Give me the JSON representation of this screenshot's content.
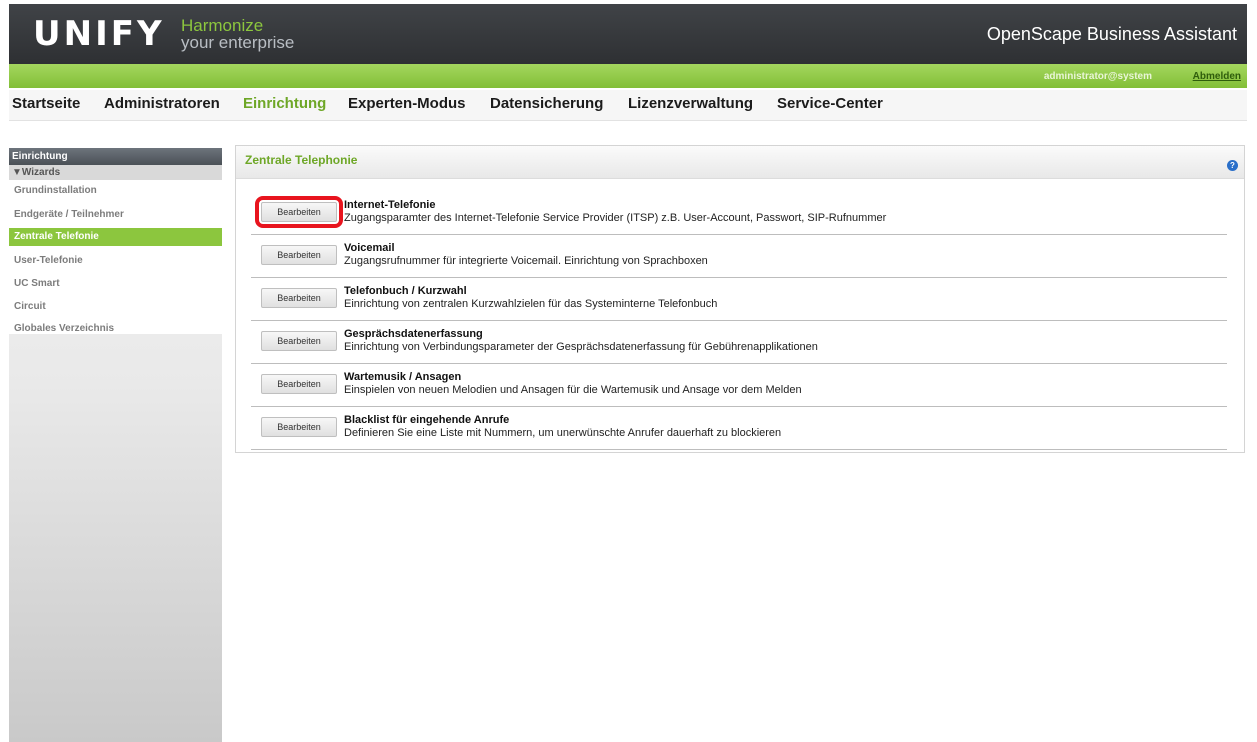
{
  "header": {
    "logo": "UNIFY",
    "tagline_line1": "Harmonize",
    "tagline_line2": "your enterprise",
    "product_title": "OpenScape Business Assistant"
  },
  "userbar": {
    "user": "administrator@system",
    "logout": "Abmelden"
  },
  "mainnav": {
    "items": [
      {
        "label": "Startseite"
      },
      {
        "label": "Administratoren"
      },
      {
        "label": "Einrichtung",
        "active": true
      },
      {
        "label": "Experten-Modus"
      },
      {
        "label": "Datensicherung"
      },
      {
        "label": "Lizenzverwaltung"
      },
      {
        "label": "Service-Center"
      }
    ]
  },
  "sidebar": {
    "heading": "Einrichtung",
    "group": "▼Wizards",
    "items": [
      {
        "label": "Grundinstallation"
      },
      {
        "label": "Endgeräte / Teilnehmer"
      },
      {
        "label": "Zentrale Telefonie",
        "active": true
      },
      {
        "label": "User-Telefonie"
      },
      {
        "label": "UC Smart"
      },
      {
        "label": "Circuit"
      },
      {
        "label": "Globales Verzeichnis"
      }
    ]
  },
  "panel": {
    "title": "Zentrale Telephonie",
    "help_icon": "help-icon",
    "rows": [
      {
        "button": "Bearbeiten",
        "title": "Internet-Telefonie",
        "desc": "Zugangsparamter des Internet-Telefonie Service Provider (ITSP) z.B. User-Account, Passwort, SIP-Rufnummer",
        "highlighted": true
      },
      {
        "button": "Bearbeiten",
        "title": "Voicemail",
        "desc": "Zugangsrufnummer für integrierte Voicemail. Einrichtung von Sprachboxen"
      },
      {
        "button": "Bearbeiten",
        "title": "Telefonbuch / Kurzwahl",
        "desc": "Einrichtung von zentralen Kurzwahlzielen für das Systeminterne Telefonbuch"
      },
      {
        "button": "Bearbeiten",
        "title": "Gesprächsdatenerfassung",
        "desc": "Einrichtung von Verbindungsparameter der Gesprächsdatenerfassung für Gebührenapplikationen"
      },
      {
        "button": "Bearbeiten",
        "title": "Wartemusik / Ansagen",
        "desc": "Einspielen von neuen Melodien und Ansagen für die Wartemusik und Ansage vor dem Melden"
      },
      {
        "button": "Bearbeiten",
        "title": "Blacklist für eingehende Anrufe",
        "desc": "Definieren Sie eine Liste mit Nummern, um unerwünschte Anrufer dauerhaft zu blockieren"
      }
    ]
  },
  "colors": {
    "accent_green": "#8cc63e",
    "header_dark": "#353739",
    "highlight_red": "#e8141e",
    "help_blue": "#2a6fc9"
  }
}
